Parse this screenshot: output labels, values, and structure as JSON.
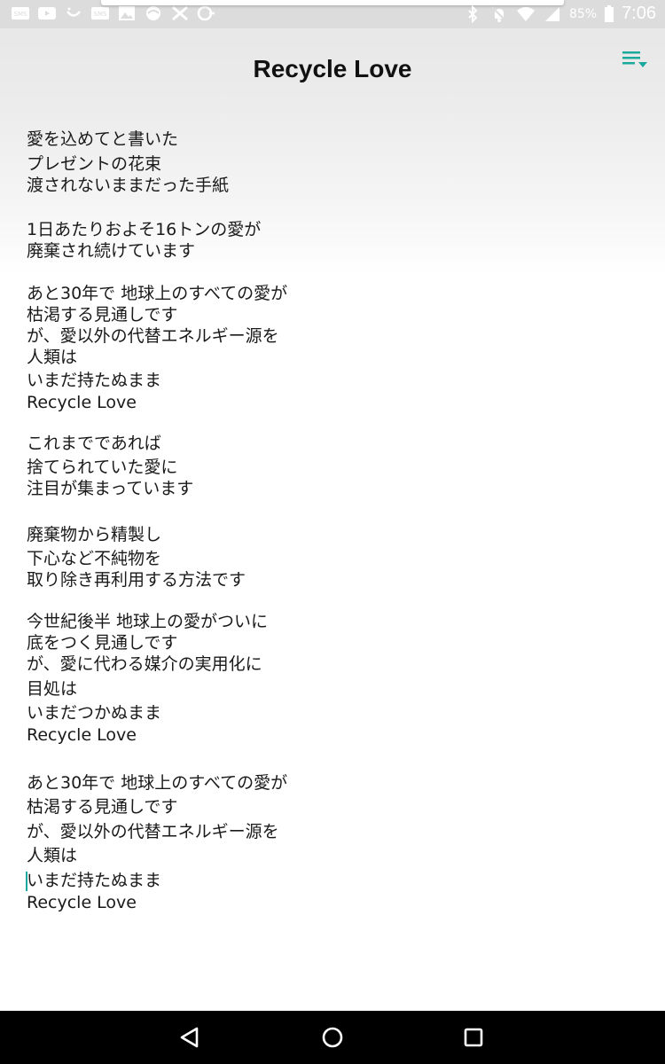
{
  "status_bar": {
    "battery": "85%",
    "time": "7:06"
  },
  "header": {
    "title": "Recycle Love",
    "menu_icon": "playlist-menu-icon",
    "accent_color": "#1aa99a"
  },
  "lyrics": [
    "愛を込めてと書いた",
    "プレゼントの花束",
    "渡されないままだった手紙",
    "1日あたりおよそ16トンの愛が",
    "廃棄され続けています",
    "あと30年で 地球上のすべての愛が",
    "枯渇する見通しです",
    "が、愛以外の代替エネルギー源を",
    "人類は",
    "いまだ持たぬまま",
    "Recycle Love",
    "これまでであれば",
    "捨てられていた愛に",
    "注目が集まっています",
    "廃棄物から精製し",
    "下心など不純物を",
    "取り除き再利用する方法です",
    "今世紀後半 地球上の愛がついに",
    "底をつく見通しです",
    "が、愛に代わる媒介の実用化に",
    "目処は",
    "いまだつかぬまま",
    "Recycle Love",
    "あと30年で 地球上のすべての愛が",
    "枯渇する見通しです",
    "が、愛以外の代替エネルギー源を",
    "人類は",
    "いまだ持たぬまま",
    "Recycle Love"
  ],
  "nav": {
    "back_icon": "back-triangle-icon",
    "home_icon": "home-circle-icon",
    "recents_icon": "recents-square-icon"
  }
}
